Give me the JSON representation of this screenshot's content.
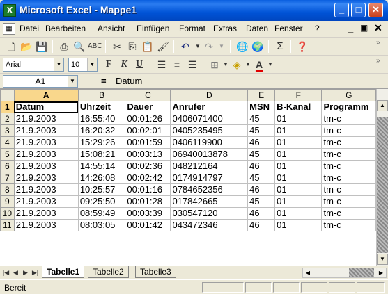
{
  "window": {
    "title": "Microsoft Excel - Mappe1",
    "app_icon": "X"
  },
  "menu": {
    "items": [
      "Datei",
      "Bearbeiten",
      "Ansicht",
      "Einfügen",
      "Format",
      "Extras",
      "Daten",
      "Fenster",
      "?"
    ]
  },
  "toolbar_format": {
    "font": "Arial",
    "size": "10",
    "bold": "F",
    "italic": "K",
    "underline": "U"
  },
  "formula_bar": {
    "name_box": "A1",
    "equals": "=",
    "content": "Datum"
  },
  "sheet": {
    "columns": [
      "A",
      "B",
      "C",
      "D",
      "E",
      "F",
      "G"
    ],
    "row_numbers": [
      "1",
      "2",
      "3",
      "4",
      "5",
      "6",
      "7",
      "8",
      "9",
      "10",
      "11"
    ],
    "header": [
      "Datum",
      "Uhrzeit",
      "Dauer",
      "Anrufer",
      "MSN",
      "B-Kanal",
      "Programm"
    ],
    "rows": [
      [
        "21.9.2003",
        "16:55:40",
        "00:01:26",
        "0406071400",
        "45",
        "01",
        "tm-c"
      ],
      [
        "21.9.2003",
        "16:20:32",
        "00:02:01",
        "0405235495",
        "45",
        "01",
        "tm-c"
      ],
      [
        "21.9.2003",
        "15:29:26",
        "00:01:59",
        "0406119900",
        "46",
        "01",
        "tm-c"
      ],
      [
        "21.9.2003",
        "15:08:21",
        "00:03:13",
        "06940013878",
        "45",
        "01",
        "tm-c"
      ],
      [
        "21.9.2003",
        "14:55:14",
        "00:02:36",
        "048212164",
        "46",
        "01",
        "tm-c"
      ],
      [
        "21.9.2003",
        "14:26:08",
        "00:02:42",
        "0174914797",
        "45",
        "01",
        "tm-c"
      ],
      [
        "21.9.2003",
        "10:25:57",
        "00:01:16",
        "0784652356",
        "46",
        "01",
        "tm-c"
      ],
      [
        "21.9.2003",
        "09:25:50",
        "00:01:28",
        "017842665",
        "45",
        "01",
        "tm-c"
      ],
      [
        "21.9.2003",
        "08:59:49",
        "00:03:39",
        "030547120",
        "46",
        "01",
        "tm-c"
      ],
      [
        "21.9.2003",
        "08:03:05",
        "00:01:42",
        "043472346",
        "46",
        "01",
        "tm-c"
      ]
    ]
  },
  "sheet_tabs": [
    "Tabelle1",
    "Tabelle2",
    "Tabelle3"
  ],
  "status": {
    "text": "Bereit"
  },
  "colors": {
    "title_bar": "#0a5fe0",
    "chrome": "#ece9d8",
    "active_header": "#f9d78c"
  }
}
